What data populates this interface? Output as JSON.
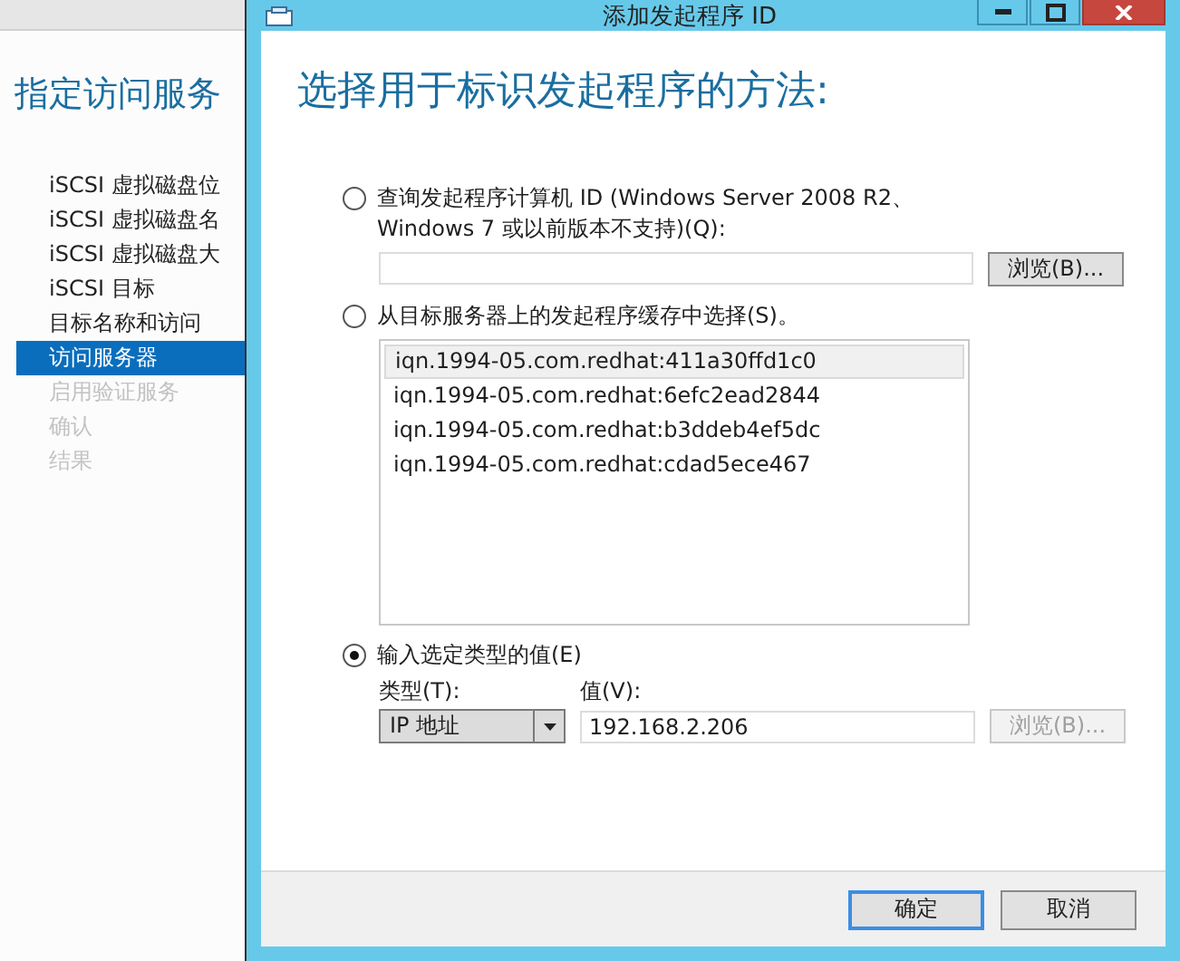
{
  "background_wizard": {
    "heading": "指定访问服务",
    "steps": [
      {
        "label": "iSCSI 虚拟磁盘位",
        "selected": false,
        "disabled": false
      },
      {
        "label": "iSCSI 虚拟磁盘名",
        "selected": false,
        "disabled": false
      },
      {
        "label": "iSCSI 虚拟磁盘大",
        "selected": false,
        "disabled": false
      },
      {
        "label": "iSCSI 目标",
        "selected": false,
        "disabled": false
      },
      {
        "label": "目标名称和访问",
        "selected": false,
        "disabled": false
      },
      {
        "label": "访问服务器",
        "selected": true,
        "disabled": false
      },
      {
        "label": "启用验证服务",
        "selected": false,
        "disabled": true
      },
      {
        "label": "确认",
        "selected": false,
        "disabled": true
      },
      {
        "label": "结果",
        "selected": false,
        "disabled": true
      }
    ]
  },
  "dialog": {
    "title": "添加发起程序 ID",
    "heading": "选择用于标识发起程序的方法:",
    "options": [
      {
        "kind": "query",
        "label": "查询发起程序计算机 ID (Windows Server 2008 R2、Windows 7 或以前版本不支持)(Q):",
        "selected": false,
        "browse_button": {
          "label": "浏览(B)...",
          "disabled": false
        }
      },
      {
        "kind": "cache",
        "label": "从目标服务器上的发起程序缓存中选择(S)。",
        "selected": false,
        "items": [
          {
            "text": "iqn.1994-05.com.redhat:411a30ffd1c0",
            "selected": true
          },
          {
            "text": "iqn.1994-05.com.redhat:6efc2ead2844",
            "selected": false
          },
          {
            "text": "iqn.1994-05.com.redhat:b3ddeb4ef5dc",
            "selected": false
          },
          {
            "text": "iqn.1994-05.com.redhat:cdad5ece467",
            "selected": false
          }
        ]
      },
      {
        "kind": "value",
        "label": "输入选定类型的值(E)",
        "selected": true,
        "type_label": "类型(T):",
        "type_value": "IP 地址",
        "value_label": "值(V):",
        "value": "192.168.2.206",
        "browse_button": {
          "label": "浏览(B)...",
          "disabled": true
        }
      }
    ],
    "buttons": [
      {
        "label": "确定",
        "focused": true
      },
      {
        "label": "取消",
        "focused": false
      }
    ]
  }
}
